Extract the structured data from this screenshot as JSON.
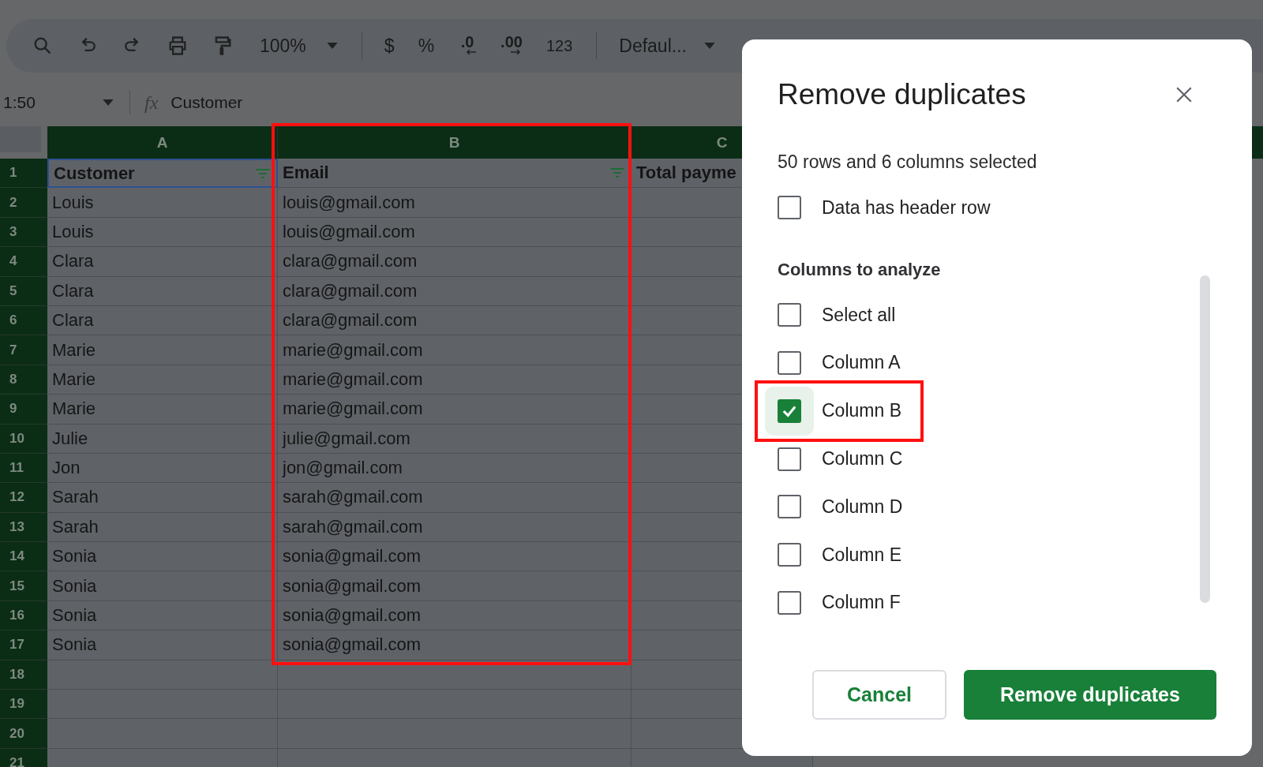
{
  "toolbar": {
    "zoom": "100%",
    "currency": "$",
    "percent": "%",
    "decrease_decimal": ".0",
    "increase_decimal": ".00",
    "number_format": "123",
    "font": "Defaul..."
  },
  "formula_bar": {
    "cell_range": "1:50",
    "fx": "fx",
    "content": "Customer"
  },
  "sheet": {
    "columns": [
      {
        "label": "A",
        "highlighted": false
      },
      {
        "label": "B",
        "highlighted": true
      },
      {
        "label": "C",
        "highlighted": false
      }
    ],
    "header_row": {
      "number": "1",
      "cells": [
        {
          "text": "Customer",
          "selected": true,
          "filter": true
        },
        {
          "text": "Email",
          "selected": false,
          "filter": true
        },
        {
          "text": "Total payme",
          "selected": false
        }
      ]
    },
    "rows": [
      {
        "number": "2",
        "cells": [
          "Louis",
          "louis@gmail.com"
        ]
      },
      {
        "number": "3",
        "cells": [
          "Louis",
          "louis@gmail.com"
        ]
      },
      {
        "number": "4",
        "cells": [
          "Clara",
          "clara@gmail.com"
        ]
      },
      {
        "number": "5",
        "cells": [
          "Clara",
          "clara@gmail.com"
        ]
      },
      {
        "number": "6",
        "cells": [
          "Clara",
          "clara@gmail.com"
        ]
      },
      {
        "number": "7",
        "cells": [
          "Marie",
          "marie@gmail.com"
        ]
      },
      {
        "number": "8",
        "cells": [
          "Marie",
          "marie@gmail.com"
        ]
      },
      {
        "number": "9",
        "cells": [
          "Marie",
          "marie@gmail.com"
        ]
      },
      {
        "number": "10",
        "cells": [
          "Julie",
          "julie@gmail.com"
        ]
      },
      {
        "number": "11",
        "cells": [
          "Jon",
          "jon@gmail.com"
        ]
      },
      {
        "number": "12",
        "cells": [
          "Sarah",
          "sarah@gmail.com"
        ]
      },
      {
        "number": "13",
        "cells": [
          "Sarah",
          "sarah@gmail.com"
        ]
      },
      {
        "number": "14",
        "cells": [
          "Sonia",
          "sonia@gmail.com"
        ]
      },
      {
        "number": "15",
        "cells": [
          "Sonia",
          "sonia@gmail.com"
        ]
      },
      {
        "number": "16",
        "cells": [
          "Sonia",
          "sonia@gmail.com"
        ]
      },
      {
        "number": "17",
        "cells": [
          "Sonia",
          "sonia@gmail.com"
        ]
      },
      {
        "number": "18"
      },
      {
        "number": "19"
      },
      {
        "number": "20"
      },
      {
        "number": "21"
      }
    ]
  },
  "dialog": {
    "title": "Remove duplicates",
    "summary": "50 rows and 6 columns selected",
    "header_option": {
      "label": "Data has header row",
      "checked": false
    },
    "section_title": "Columns to analyze",
    "options": [
      {
        "label": "Select all",
        "checked": false,
        "focused": false,
        "highlighted": false
      },
      {
        "label": "Column A",
        "checked": false,
        "focused": false,
        "highlighted": false
      },
      {
        "label": "Column B",
        "checked": true,
        "focused": true,
        "highlighted": true
      },
      {
        "label": "Column C",
        "checked": false,
        "focused": false,
        "highlighted": false
      },
      {
        "label": "Column D",
        "checked": false,
        "focused": false,
        "highlighted": false
      },
      {
        "label": "Column E",
        "checked": false,
        "focused": false,
        "highlighted": false
      },
      {
        "label": "Column F",
        "checked": false,
        "focused": false,
        "highlighted": false
      }
    ],
    "buttons": [
      {
        "label": "Cancel",
        "kind": "secondary"
      },
      {
        "label": "Remove duplicates",
        "kind": "primary"
      }
    ]
  }
}
